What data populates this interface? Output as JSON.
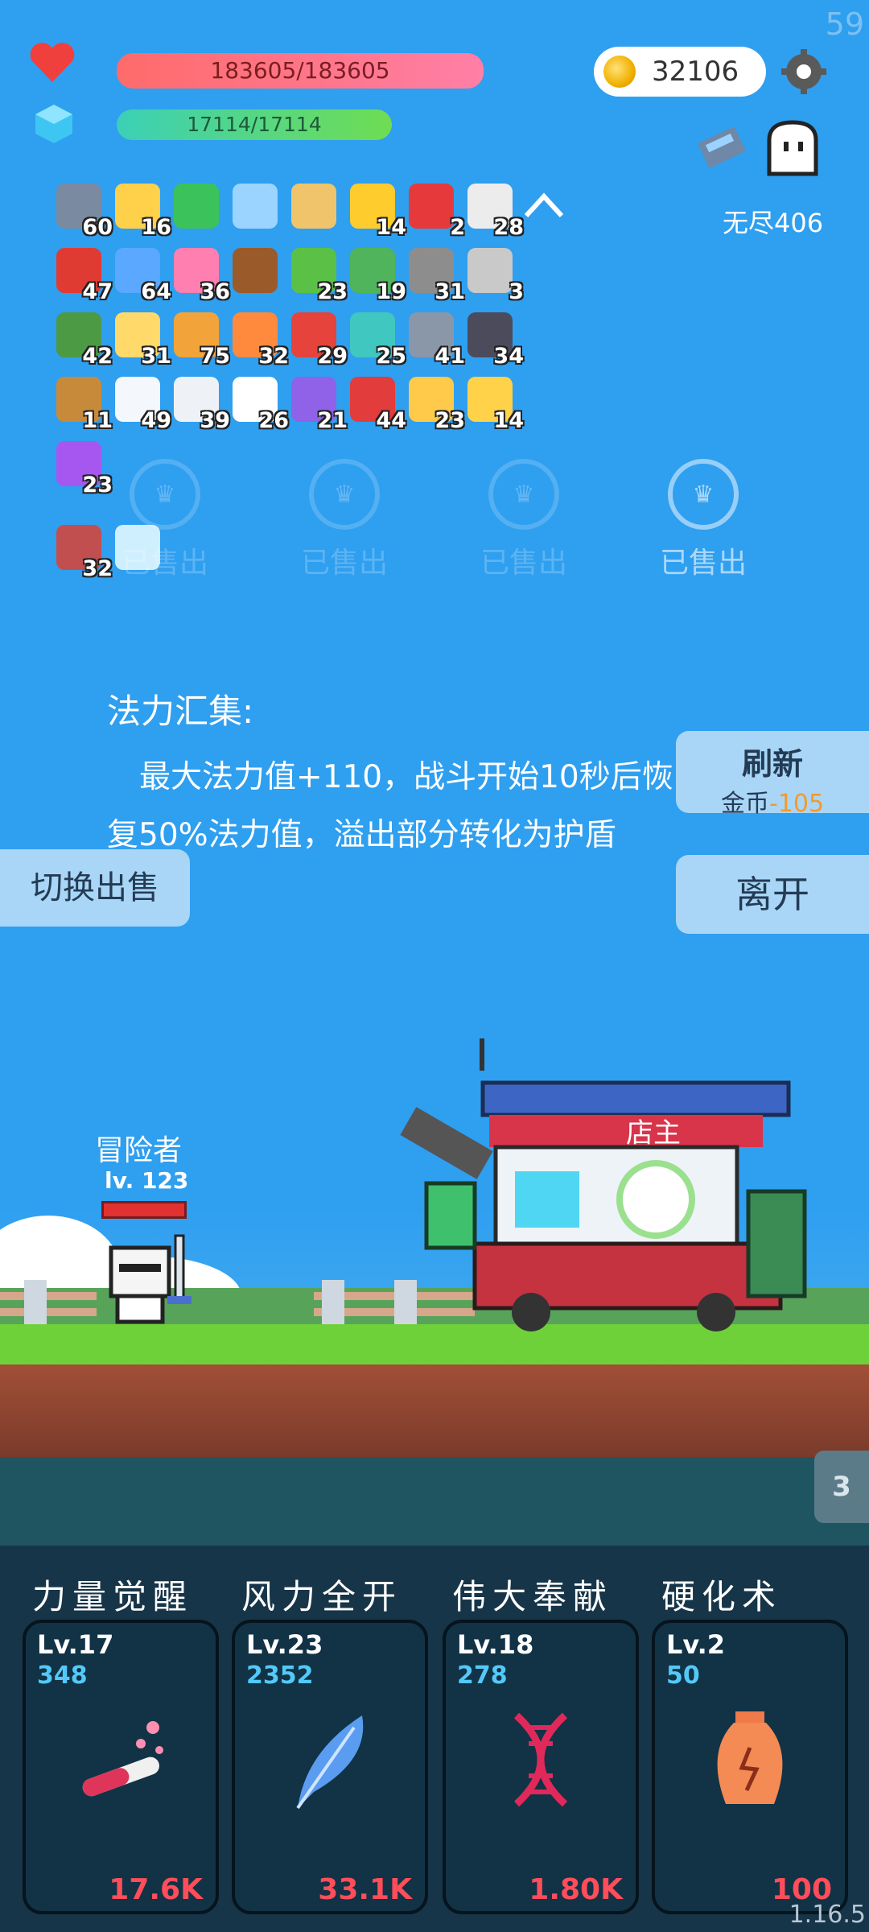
{
  "hud": {
    "fps": "59",
    "hp": "183605/183605",
    "mp": "17114/17114",
    "gold": "32106",
    "endless": "无尽406",
    "version": "1.16.5"
  },
  "items": [
    {
      "icon": "sword-icon",
      "count": "60",
      "color": "#7a8aa0"
    },
    {
      "icon": "sun-icon",
      "count": "16",
      "color": "#ffd04a"
    },
    {
      "icon": "green-card-icon",
      "count": "",
      "color": "#3cc25a"
    },
    {
      "icon": "magnifier-icon",
      "count": "",
      "color": "#9ad4ff"
    },
    {
      "icon": "scroll-icon",
      "count": "",
      "color": "#f0c46a"
    },
    {
      "icon": "crown-icon",
      "count": "14",
      "color": "#ffcc2e"
    },
    {
      "icon": "percent-tag-icon",
      "count": "2",
      "color": "#e6393b"
    },
    {
      "icon": "dice-icon",
      "count": "28",
      "color": "#ececec"
    },
    {
      "icon": "mushroom-icon",
      "count": "47",
      "color": "#e03b32"
    },
    {
      "icon": "star-card-icon",
      "count": "64",
      "color": "#5aa8ff"
    },
    {
      "icon": "potion-bottle-icon",
      "count": "36",
      "color": "#ff7fb0"
    },
    {
      "icon": "treasure-chest-icon",
      "count": "",
      "color": "#9b5a2a"
    },
    {
      "icon": "slime-icon",
      "count": "23",
      "color": "#5ac146"
    },
    {
      "icon": "money-heart-icon",
      "count": "19",
      "color": "#4fb45c"
    },
    {
      "icon": "spiked-ball-icon",
      "count": "31",
      "color": "#8d8d8d"
    },
    {
      "icon": "compass-icon",
      "count": "3",
      "color": "#c9c9c9"
    },
    {
      "icon": "helmet-icon",
      "count": "42",
      "color": "#4d9a45"
    },
    {
      "icon": "note-pencil-icon",
      "count": "31",
      "color": "#ffd96a"
    },
    {
      "icon": "book-icon",
      "count": "75",
      "color": "#f2a33a"
    },
    {
      "icon": "meteor-icon",
      "count": "32",
      "color": "#ff8a3d"
    },
    {
      "icon": "gift-box-icon",
      "count": "29",
      "color": "#e5433b"
    },
    {
      "icon": "target-icon",
      "count": "25",
      "color": "#3fc7c0"
    },
    {
      "icon": "elephant-icon",
      "count": "41",
      "color": "#8a97a8"
    },
    {
      "icon": "bat-icon",
      "count": "34",
      "color": "#4b4b5c"
    },
    {
      "icon": "crossbow-icon",
      "count": "11",
      "color": "#c78a3a"
    },
    {
      "icon": "cloud-icon",
      "count": "49",
      "color": "#f4f7fb"
    },
    {
      "icon": "envelope-icon",
      "count": "39",
      "color": "#eef2f6"
    },
    {
      "icon": "ghost-icon",
      "count": "26",
      "color": "#ffffff"
    },
    {
      "icon": "purple-box-icon",
      "count": "21",
      "color": "#8f62e8"
    },
    {
      "icon": "thermometer-icon",
      "count": "44",
      "color": "#e23c3c"
    },
    {
      "icon": "ring-icon",
      "count": "23",
      "color": "#ffc94a"
    },
    {
      "icon": "magic-wand-icon",
      "count": "14",
      "color": "#ffd24a"
    },
    {
      "icon": "purple-orb-icon",
      "count": "23",
      "color": "#a657f0"
    },
    {
      "icon": "striped-card-icon",
      "count": "32",
      "color": "#c24f4f"
    },
    {
      "icon": "lightbulb-icon",
      "count": "",
      "color": "#cfefff"
    }
  ],
  "shop": {
    "sold_label": "已售出",
    "desc_title": "法力汇集:",
    "desc_body": "最大法力值+110，战斗开始10秒后恢复50%法力值，溢出部分转化为护盾",
    "refresh_label": "刷新",
    "refresh_currency": "金币",
    "refresh_price": "-105",
    "leave_label": "离开",
    "switch_label": "切换出售"
  },
  "scene": {
    "player_name": "冒险者",
    "player_level": "lv. 123",
    "shopkeeper": "店主",
    "wave": "3"
  },
  "skills": [
    {
      "name": "力量觉醒",
      "level": "Lv.17",
      "value": "348",
      "cost": "17.6K",
      "icon": "test-tube-icon"
    },
    {
      "name": "风力全开",
      "level": "Lv.23",
      "value": "2352",
      "cost": "33.1K",
      "icon": "feather-icon"
    },
    {
      "name": "伟大奉献",
      "level": "Lv.18",
      "value": "278",
      "cost": "1.80K",
      "icon": "dna-icon"
    },
    {
      "name": "硬化术",
      "level": "Lv.2",
      "value": "50",
      "cost": "100",
      "icon": "vase-icon"
    }
  ]
}
